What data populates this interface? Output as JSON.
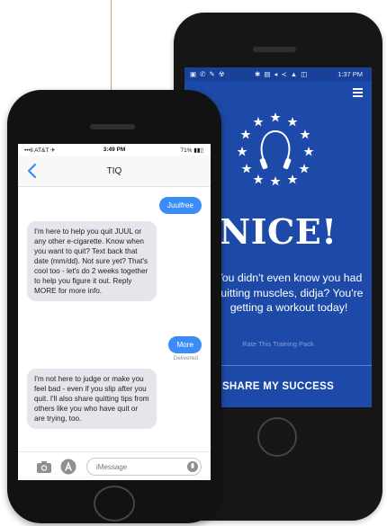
{
  "android_phone": {
    "status_bar": {
      "icons": "▣ ✆ ✎ ☢",
      "right_icons": "✱ ▤ ◂ ≺ ▲ ◫",
      "time": "1:37 PM"
    },
    "badge_icon": "jump-rope-stars-badge",
    "title": "NICE!",
    "message": "You didn't even know you had quitting muscles, didja? You're getting a workout today!",
    "training_link": "Rate This Training Pack",
    "share_button": "SHARE MY SUCCESS",
    "colors": {
      "screen_bg": "#1d49a8",
      "text": "#ffffff"
    }
  },
  "iphone": {
    "status_bar": {
      "carrier": "•••ll AT&T ✈",
      "time": "3:49 PM",
      "battery": "71% ▮▮▯"
    },
    "contact": "TIQ",
    "messages": [
      {
        "direction": "out",
        "text": "Juulfree"
      },
      {
        "direction": "in",
        "text": "I'm here to help you quit JUUL or any other e-cigarette. Know when you want to quit? Text back that date (mm/dd). Not sure yet? That's cool too - let's do 2 weeks together to help you figure it out. Reply MORE for more info."
      },
      {
        "direction": "out",
        "text": "More"
      },
      {
        "direction": "in",
        "text": "I'm not here to judge or make you feel bad - even if you slip after you quit. I'll also share quitting tips from others like you who have quit or are trying, too."
      }
    ],
    "delivered_label": "Delivered",
    "compose": {
      "placeholder": "iMessage"
    },
    "colors": {
      "outgoing_bubble": "#3a8df7",
      "incoming_bubble": "#e6e5eb"
    }
  }
}
